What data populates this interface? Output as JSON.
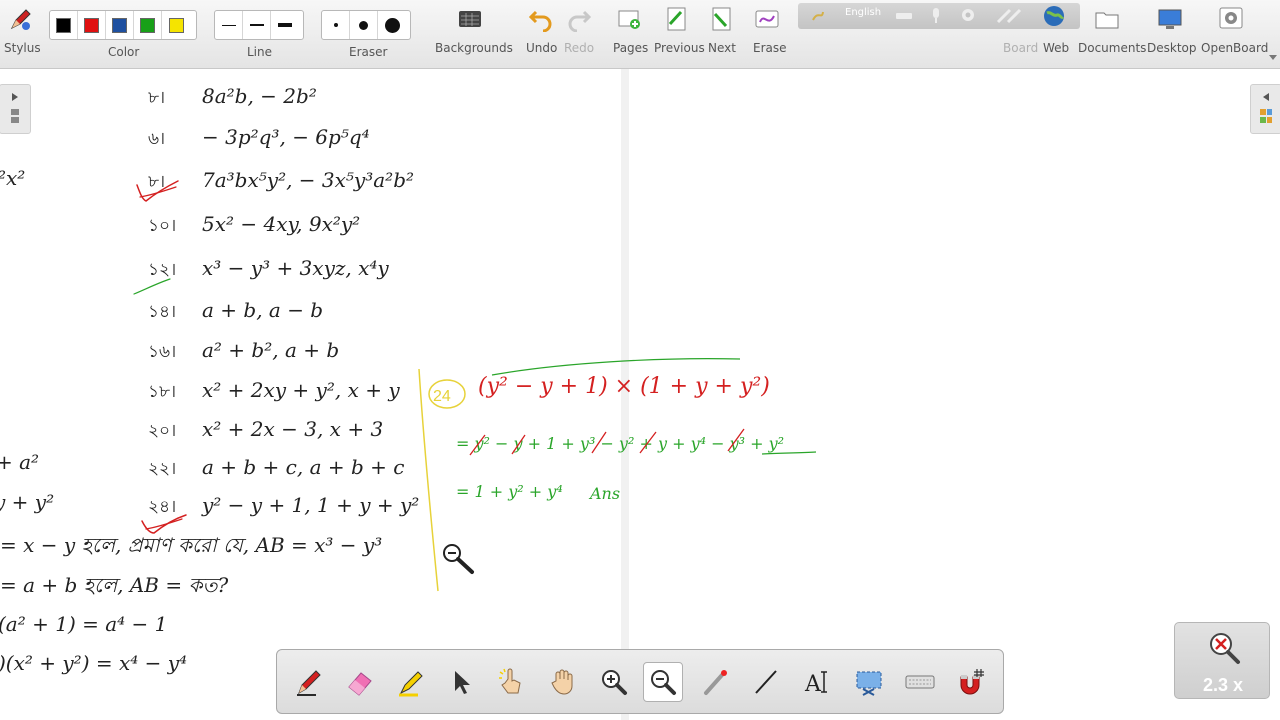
{
  "toolbar": {
    "stylus": "Stylus",
    "color": "Color",
    "line": "Line",
    "eraser": "Eraser",
    "backgrounds": "Backgrounds",
    "undo": "Undo",
    "redo": "Redo",
    "pages": "Pages",
    "previous": "Previous",
    "next": "Next",
    "erase": "Erase",
    "board": "Board",
    "web": "Web",
    "documents": "Documents",
    "desktop": "Desktop",
    "openboard": "OpenBoard",
    "language": "English",
    "colors": [
      "#000000",
      "#e01010",
      "#1e50a0",
      "#18a018",
      "#f5e400"
    ]
  },
  "problems": [
    {
      "num": "৮।",
      "expr": "8a²b, − 2b²"
    },
    {
      "num": "৬।",
      "expr": "− 3p²q³, − 6p⁵q⁴"
    },
    {
      "num": "৮।",
      "expr": "7a³bx⁵y², − 3x⁵y³a²b²"
    },
    {
      "num": "১০।",
      "expr": "5x² − 4xy, 9x²y²"
    },
    {
      "num": "১২।",
      "expr": "x³ − y³ + 3xyz, x⁴y"
    },
    {
      "num": "১৪।",
      "expr": "a + b, a − b"
    },
    {
      "num": "১৬।",
      "expr": "a² + b², a + b"
    },
    {
      "num": "১৮।",
      "expr": "x² + 2xy + y², x + y"
    },
    {
      "num": "২০।",
      "expr": "x² + 2x − 3, x + 3"
    },
    {
      "num": "২২।",
      "expr": "a + b + c, a + b + c"
    },
    {
      "num": "২৪।",
      "expr": "y² − y + 1, 1 + y + y²"
    }
  ],
  "left_fragments": [
    "²x²",
    "+ a²",
    "y + y²"
  ],
  "statements": [
    "= x − y হলে, প্রমাণ করো যে, AB = x³ − y³",
    "= a + b হলে, AB = কত?",
    "(a² + 1) = a⁴ − 1",
    ")(x² + y²) = x⁴ − y⁴"
  ],
  "handwriting": {
    "label": "24",
    "line1": "(y² − y + 1) × (1 + y + y²)",
    "line2": "= y² − y + 1 + y³ − y² + y + y⁴ − y³ + y²",
    "line3": "= 1 + y² + y⁴",
    "ans": "Ans"
  },
  "zoom": {
    "level": "2.3 x"
  },
  "colors": {
    "green_ink": "#2aa52a",
    "red_ink": "#d42020",
    "yellow_ink": "#e7d23a"
  }
}
